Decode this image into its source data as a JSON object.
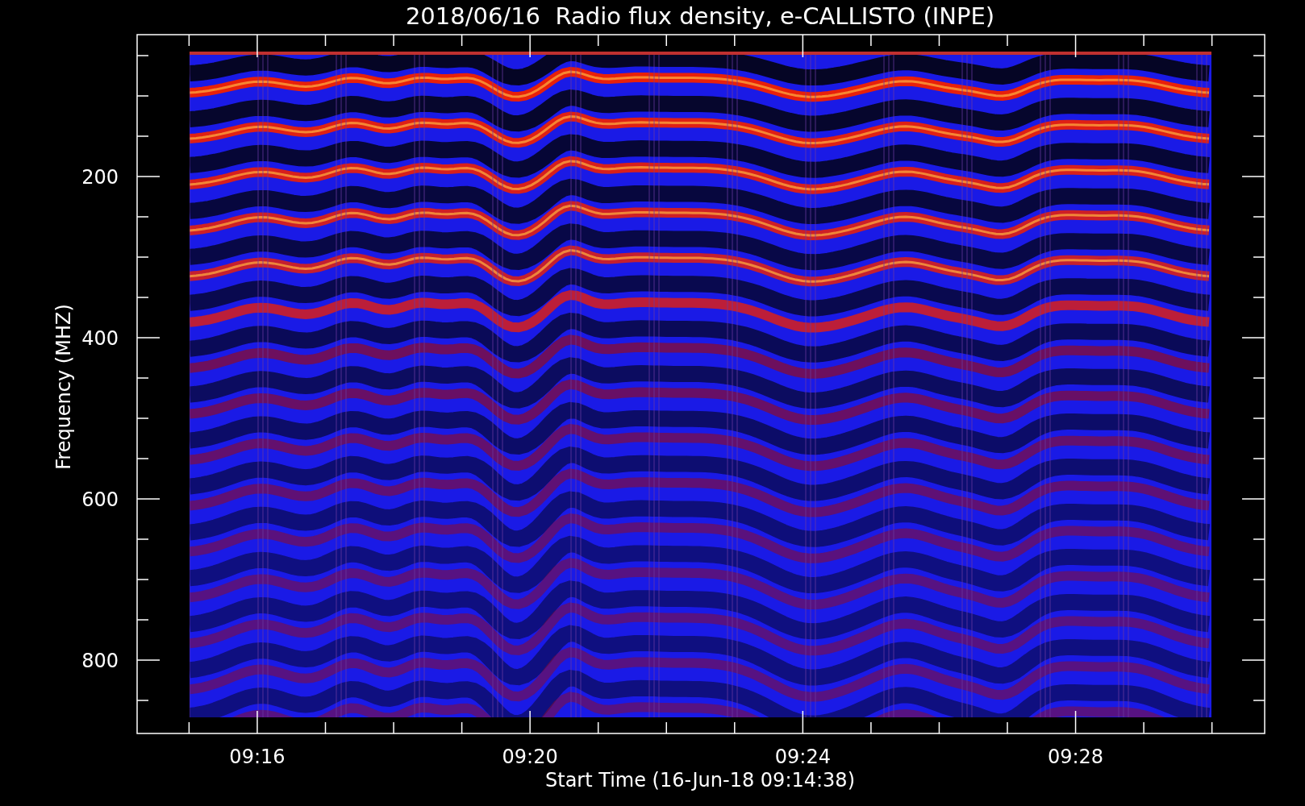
{
  "title": "2018/06/16  Radio flux density, e-CALLISTO (INPE)",
  "plot": {
    "ylabel": "Frequency (MHZ)",
    "xlabel": "Start Time (16-Jun-18 09:14:38)",
    "yticks": [
      "200",
      "400",
      "600",
      "800"
    ],
    "xticks": [
      "09:16",
      "09:20",
      "09:24",
      "09:28"
    ]
  }
}
